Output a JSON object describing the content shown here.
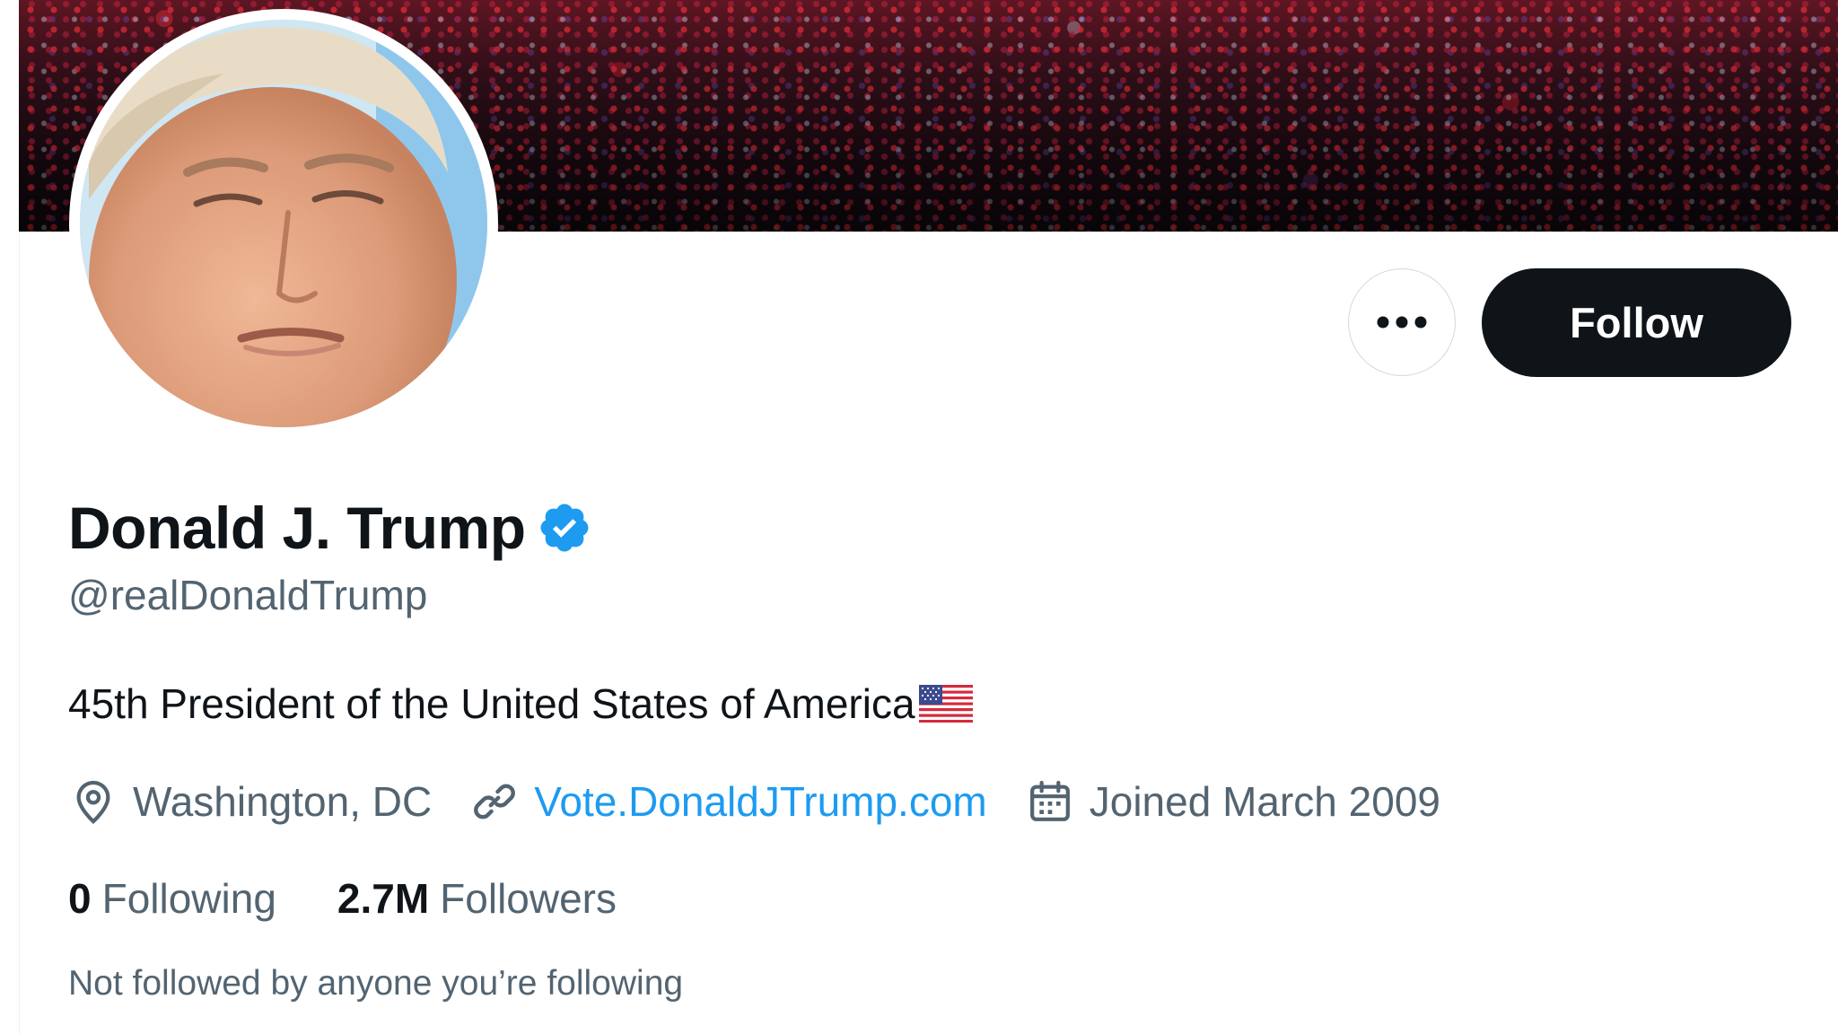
{
  "profile": {
    "display_name": "Donald J. Trump",
    "handle": "@realDonaldTrump",
    "verified": true,
    "bio": "45th President of the United States of America",
    "bio_emoji": "us-flag-emoji",
    "location": "Washington, DC",
    "website": "Vote.DonaldJTrump.com",
    "joined": "Joined March 2009"
  },
  "stats": {
    "following_count": "0",
    "following_label": "Following",
    "followers_count": "2.7M",
    "followers_label": "Followers"
  },
  "followed_by_text": "Not followed by anyone you’re following",
  "actions": {
    "more_icon": "more-horizontal-icon",
    "follow_label": "Follow"
  },
  "icons": {
    "location": "location-pin-icon",
    "link": "link-icon",
    "calendar": "calendar-icon",
    "verified": "verified-badge-icon"
  },
  "colors": {
    "text_primary": "#0f1419",
    "text_secondary": "#536471",
    "link": "#1d9bf0",
    "verified": "#1d9bf0",
    "follow_button_bg": "#0f1419",
    "follow_button_text": "#ffffff",
    "border": "#cfd9de"
  }
}
